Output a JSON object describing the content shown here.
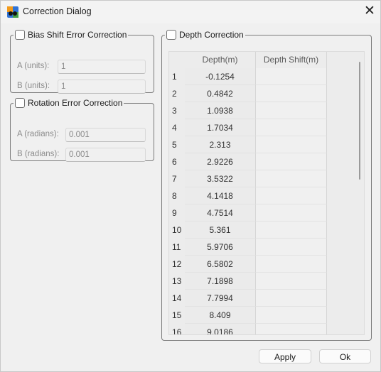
{
  "window": {
    "title": "Correction Dialog",
    "close_glyph": "✕"
  },
  "bias": {
    "legend": "Bias Shift Error Correction",
    "a_label": "A (units):",
    "a_value": "1",
    "b_label": "B (units):",
    "b_value": "1"
  },
  "rotation": {
    "legend": "Rotation Error Correction",
    "a_label": "A (radians):",
    "a_value": "0.001",
    "b_label": "B (radians):",
    "b_value": "0.001"
  },
  "depth": {
    "legend": "Depth Correction",
    "columns": [
      "Depth(m)",
      "Depth Shift(m)"
    ],
    "rows": [
      {
        "index": "1",
        "depth": "-0.1254",
        "shift": ""
      },
      {
        "index": "2",
        "depth": "0.4842",
        "shift": ""
      },
      {
        "index": "3",
        "depth": "1.0938",
        "shift": ""
      },
      {
        "index": "4",
        "depth": "1.7034",
        "shift": ""
      },
      {
        "index": "5",
        "depth": "2.313",
        "shift": ""
      },
      {
        "index": "6",
        "depth": "2.9226",
        "shift": ""
      },
      {
        "index": "7",
        "depth": "3.5322",
        "shift": ""
      },
      {
        "index": "8",
        "depth": "4.1418",
        "shift": ""
      },
      {
        "index": "9",
        "depth": "4.7514",
        "shift": ""
      },
      {
        "index": "10",
        "depth": "5.361",
        "shift": ""
      },
      {
        "index": "11",
        "depth": "5.9706",
        "shift": ""
      },
      {
        "index": "12",
        "depth": "6.5802",
        "shift": ""
      },
      {
        "index": "13",
        "depth": "7.1898",
        "shift": ""
      },
      {
        "index": "14",
        "depth": "7.7994",
        "shift": ""
      },
      {
        "index": "15",
        "depth": "8.409",
        "shift": ""
      },
      {
        "index": "16",
        "depth": "9.0186",
        "shift": ""
      }
    ]
  },
  "buttons": {
    "apply": "Apply",
    "ok": "Ok"
  }
}
